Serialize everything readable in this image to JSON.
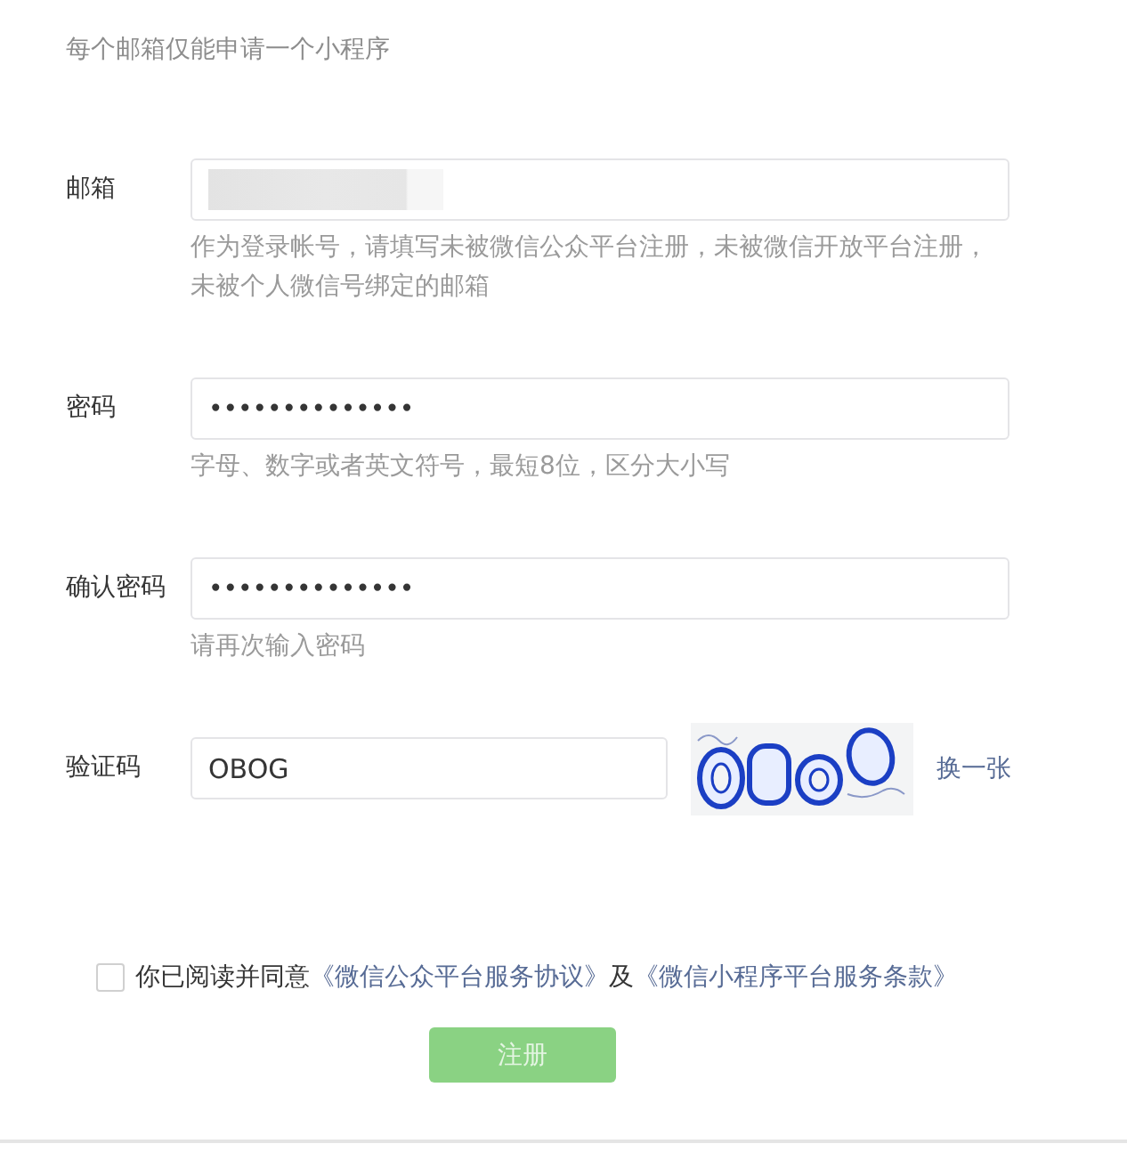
{
  "notice": "每个邮箱仅能申请一个小程序",
  "fields": [
    {
      "kind": "redacted",
      "label": "邮箱",
      "hint": "作为登录帐号，请填写未被微信公众平台注册，未被微信开放平台注册，未被个人微信号绑定的邮箱"
    },
    {
      "kind": "text",
      "label": "密码",
      "value": "••••••••••••••",
      "hint": "字母、数字或者英文符号，最短8位，区分大小写"
    },
    {
      "kind": "text",
      "label": "确认密码",
      "value": "••••••••••••••",
      "hint": "请再次输入密码"
    },
    {
      "kind": "captcha",
      "label": "验证码",
      "value": "OBOG",
      "refresh_link": "换一张"
    }
  ],
  "agreement": {
    "checked": false,
    "parts": [
      {
        "kind": "text",
        "text": "你已阅读并同意"
      },
      {
        "kind": "link",
        "text": "《微信公众平台服务协议》"
      },
      {
        "kind": "text",
        "text": "及"
      },
      {
        "kind": "link",
        "text": "《微信小程序平台服务条款》"
      }
    ]
  },
  "submit": {
    "label": "注册",
    "disabled": true
  }
}
